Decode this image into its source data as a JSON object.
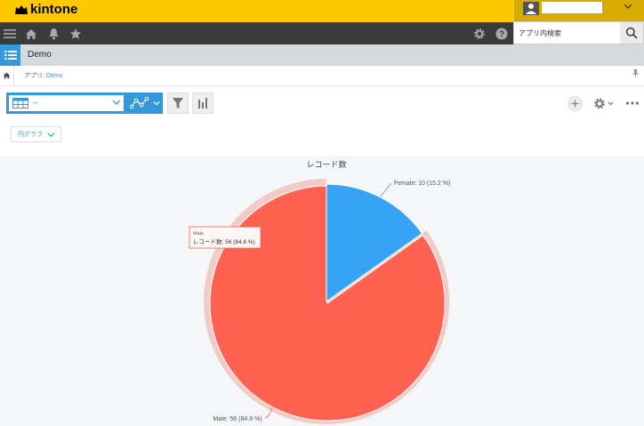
{
  "header": {
    "logo_text": "kintone",
    "search": {
      "placeholder": "アプリ内検索"
    }
  },
  "icons": {
    "menu": "hamburger-icon",
    "home": "home-icon",
    "notifications": "bell-icon",
    "favorites": "star-icon",
    "settings": "gear-icon",
    "help": "question-icon",
    "search": "search-icon"
  },
  "app": {
    "name": "Demo",
    "breadcrumb": {
      "prefix": "アプリ: ",
      "link": "Demo"
    }
  },
  "toolbar": {
    "view_select_value": "--",
    "chart_type_label": "円グラフ"
  },
  "colors": {
    "brand_yellow": "#fcc800",
    "nav_dark": "#3b3b3b",
    "accent_blue": "#3498db",
    "male": "#ff6150",
    "female": "#37a3f4"
  },
  "chart_data": {
    "type": "pie",
    "title": "レコード数",
    "categories": [
      "Male",
      "Female"
    ],
    "values": [
      56,
      10
    ],
    "percents": [
      84.8,
      15.2
    ],
    "labels": [
      "Male: 56 (84.8 %)",
      "Female: 10 (15.2 %)"
    ],
    "tooltip": {
      "category": "Male",
      "text": "レコード数: 56 (84.8 %)"
    }
  }
}
